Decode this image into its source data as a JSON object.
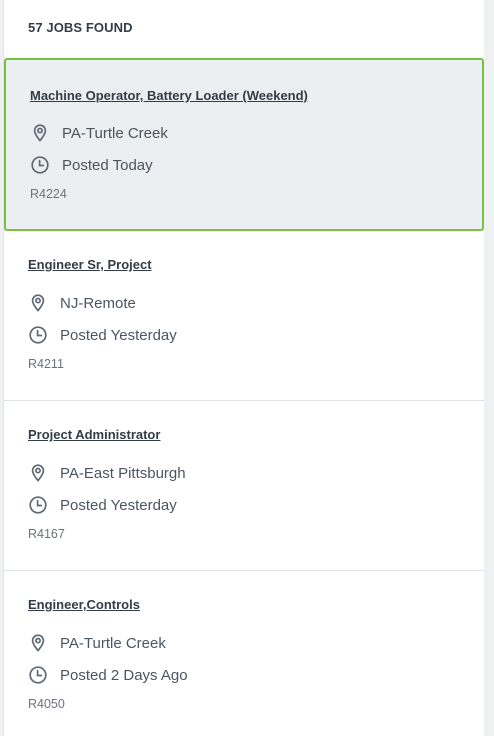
{
  "results": {
    "count_label": "57 JOBS FOUND"
  },
  "jobs": [
    {
      "title": "Machine Operator, Battery Loader (Weekend)",
      "location": "PA-Turtle Creek",
      "posted": "Posted Today",
      "req_id": "R4224",
      "selected": true
    },
    {
      "title": "Engineer Sr, Project",
      "location": "NJ-Remote",
      "posted": "Posted Yesterday",
      "req_id": "R4211",
      "selected": false
    },
    {
      "title": "Project Administrator",
      "location": "PA-East Pittsburgh",
      "posted": "Posted Yesterday",
      "req_id": "R4167",
      "selected": false
    },
    {
      "title": "Engineer,Controls",
      "location": "PA-Turtle Creek",
      "posted": "Posted 2 Days Ago",
      "req_id": "R4050",
      "selected": false
    }
  ],
  "icons": {
    "location": "location-pin-icon",
    "posted": "clock-icon"
  },
  "colors": {
    "selected_border": "#77c043",
    "selected_background": "#eceff2",
    "text_primary": "#333d47",
    "text_secondary": "#4b5560",
    "icon": "#5f6a75"
  }
}
